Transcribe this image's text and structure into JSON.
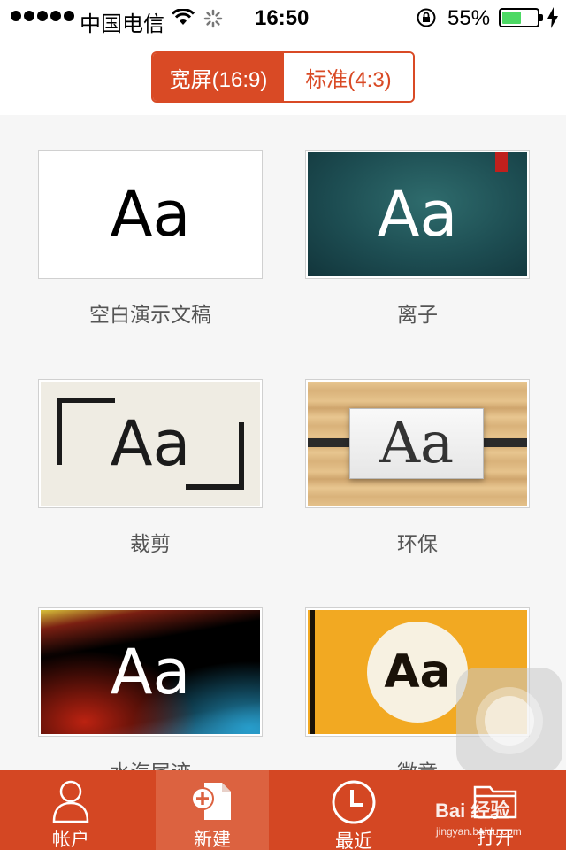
{
  "status_bar": {
    "carrier": "中国电信",
    "time": "16:50",
    "battery_percent": "55%",
    "battery_level": 0.55
  },
  "segmented_control": {
    "options": [
      {
        "label": "宽屏(16:9)",
        "selected": true
      },
      {
        "label": "标准(4:3)",
        "selected": false
      }
    ],
    "accent_color": "#d94a25"
  },
  "templates": [
    {
      "name": "空白演示文稿",
      "sample": "Aa",
      "theme": "blank"
    },
    {
      "name": "离子",
      "sample": "Aa",
      "theme": "ion"
    },
    {
      "name": "裁剪",
      "sample": "Aa",
      "theme": "crop"
    },
    {
      "name": "环保",
      "sample": "Aa",
      "theme": "eco"
    },
    {
      "name": "水汽尾迹",
      "sample": "Aa",
      "theme": "vapor-trail"
    },
    {
      "name": "徽章",
      "sample": "Aa",
      "theme": "badge"
    }
  ],
  "tab_bar": {
    "background_color": "#d44723",
    "items": [
      {
        "label": "帐户",
        "icon": "person-icon",
        "active": false
      },
      {
        "label": "新建",
        "icon": "new-document-icon",
        "active": true
      },
      {
        "label": "最近",
        "icon": "clock-icon",
        "active": false
      },
      {
        "label": "打开",
        "icon": "folder-icon",
        "active": false
      }
    ]
  },
  "watermark": {
    "brand": "Bai 经验",
    "url": "jingyan.baidu.com"
  }
}
